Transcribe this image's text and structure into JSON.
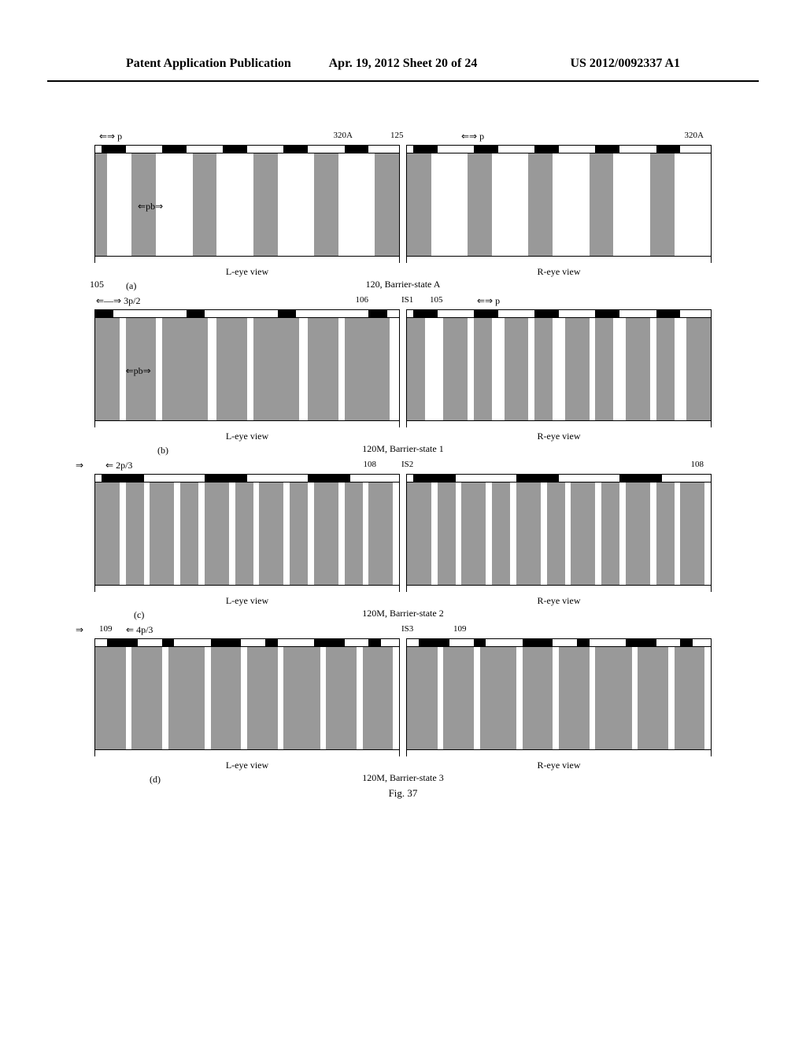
{
  "header": {
    "left": "Patent Application Publication",
    "center": "Apr. 19, 2012  Sheet 20 of 24",
    "right": "US 2012/0092337 A1"
  },
  "rows": [
    {
      "id": "a",
      "row_label": "(a)",
      "pitch_label": "p",
      "inner_pitch_label": "pb",
      "ref_320": "320A",
      "ref_125": "125",
      "ref_105": "105",
      "left_caption": "L-eye view",
      "right_caption": "R-eye view",
      "center_caption": "120, Barrier-state A"
    },
    {
      "id": "b",
      "row_label": "(b)",
      "pitch_label": "3p/2",
      "inner_pitch_label": "pb",
      "right_pitch_label": "p",
      "ref_106": "106",
      "ref_105": "105",
      "is_label": "IS1",
      "left_caption": "L-eye view",
      "right_caption": "R-eye view",
      "center_caption": "120M, Barrier-state 1"
    },
    {
      "id": "c",
      "row_label": "(c)",
      "pitch_label": "2p/3",
      "ref_108": "108",
      "is_label": "IS2",
      "left_caption": "L-eye view",
      "right_caption": "R-eye view",
      "center_caption": "120M, Barrier-state 2"
    },
    {
      "id": "d",
      "row_label": "(d)",
      "pitch_label": "4p/3",
      "ref_109": "109",
      "is_label": "IS3",
      "left_caption": "L-eye view",
      "right_caption": "R-eye view",
      "center_caption": "120M, Barrier-state 3"
    }
  ],
  "figure_caption": "Fig. 37",
  "chart_data": {
    "type": "diagram",
    "description": "Four rows (a-d) each showing left-eye and right-eye barrier views. Each diagram has a top strip with alternating black opaque segments and a body with vertical gray bars representing barrier slits at different pitches.",
    "row_a": {
      "barrier_state": "A",
      "black_segments_pct": [
        {
          "x": 2,
          "w": 8
        },
        {
          "x": 22,
          "w": 8
        },
        {
          "x": 42,
          "w": 8
        },
        {
          "x": 62,
          "w": 8
        },
        {
          "x": 82,
          "w": 8
        }
      ],
      "gray_bars_pct": [
        {
          "x": 0,
          "w": 4
        },
        {
          "x": 12,
          "w": 8
        },
        {
          "x": 32,
          "w": 8
        },
        {
          "x": 52,
          "w": 8
        },
        {
          "x": 72,
          "w": 8
        },
        {
          "x": 92,
          "w": 8
        }
      ],
      "pitch": "p"
    },
    "row_b": {
      "barrier_state": "1",
      "left_black_segments_pct": [
        {
          "x": 0,
          "w": 6
        },
        {
          "x": 30,
          "w": 6
        },
        {
          "x": 60,
          "w": 6
        },
        {
          "x": 90,
          "w": 6
        }
      ],
      "left_gray_bars_pct": [
        {
          "x": 0,
          "w": 8
        },
        {
          "x": 10,
          "w": 10
        },
        {
          "x": 22,
          "w": 15
        },
        {
          "x": 40,
          "w": 10
        },
        {
          "x": 52,
          "w": 15
        },
        {
          "x": 70,
          "w": 10
        },
        {
          "x": 82,
          "w": 15
        }
      ],
      "right_black_segments_pct": [
        {
          "x": 2,
          "w": 8
        },
        {
          "x": 22,
          "w": 8
        },
        {
          "x": 42,
          "w": 8
        },
        {
          "x": 62,
          "w": 8
        },
        {
          "x": 82,
          "w": 8
        }
      ],
      "right_gray_bars_pct": [
        {
          "x": 0,
          "w": 6
        },
        {
          "x": 12,
          "w": 8
        },
        {
          "x": 22,
          "w": 6
        },
        {
          "x": 32,
          "w": 8
        },
        {
          "x": 42,
          "w": 6
        },
        {
          "x": 52,
          "w": 8
        },
        {
          "x": 62,
          "w": 6
        },
        {
          "x": 72,
          "w": 8
        },
        {
          "x": 82,
          "w": 6
        },
        {
          "x": 92,
          "w": 8
        }
      ],
      "pitch": "3p/2"
    },
    "row_c": {
      "barrier_state": "2",
      "black_segments_pct": [
        {
          "x": 2,
          "w": 14
        },
        {
          "x": 36,
          "w": 14
        },
        {
          "x": 70,
          "w": 14
        }
      ],
      "gray_bars_pct": [
        {
          "x": 0,
          "w": 8
        },
        {
          "x": 10,
          "w": 6
        },
        {
          "x": 18,
          "w": 8
        },
        {
          "x": 28,
          "w": 6
        },
        {
          "x": 36,
          "w": 8
        },
        {
          "x": 46,
          "w": 6
        },
        {
          "x": 54,
          "w": 8
        },
        {
          "x": 64,
          "w": 6
        },
        {
          "x": 72,
          "w": 8
        },
        {
          "x": 82,
          "w": 6
        },
        {
          "x": 90,
          "w": 8
        }
      ],
      "pitch": "2p/3",
      "offset": "small"
    },
    "row_d": {
      "barrier_state": "3",
      "black_segments_pct": [
        {
          "x": 4,
          "w": 10
        },
        {
          "x": 22,
          "w": 4
        },
        {
          "x": 38,
          "w": 10
        },
        {
          "x": 56,
          "w": 4
        },
        {
          "x": 72,
          "w": 10
        },
        {
          "x": 90,
          "w": 4
        }
      ],
      "gray_bars_pct": [
        {
          "x": 0,
          "w": 10
        },
        {
          "x": 12,
          "w": 10
        },
        {
          "x": 24,
          "w": 12
        },
        {
          "x": 38,
          "w": 10
        },
        {
          "x": 50,
          "w": 10
        },
        {
          "x": 62,
          "w": 12
        },
        {
          "x": 76,
          "w": 10
        },
        {
          "x": 88,
          "w": 10
        }
      ],
      "pitch": "4p/3"
    }
  }
}
